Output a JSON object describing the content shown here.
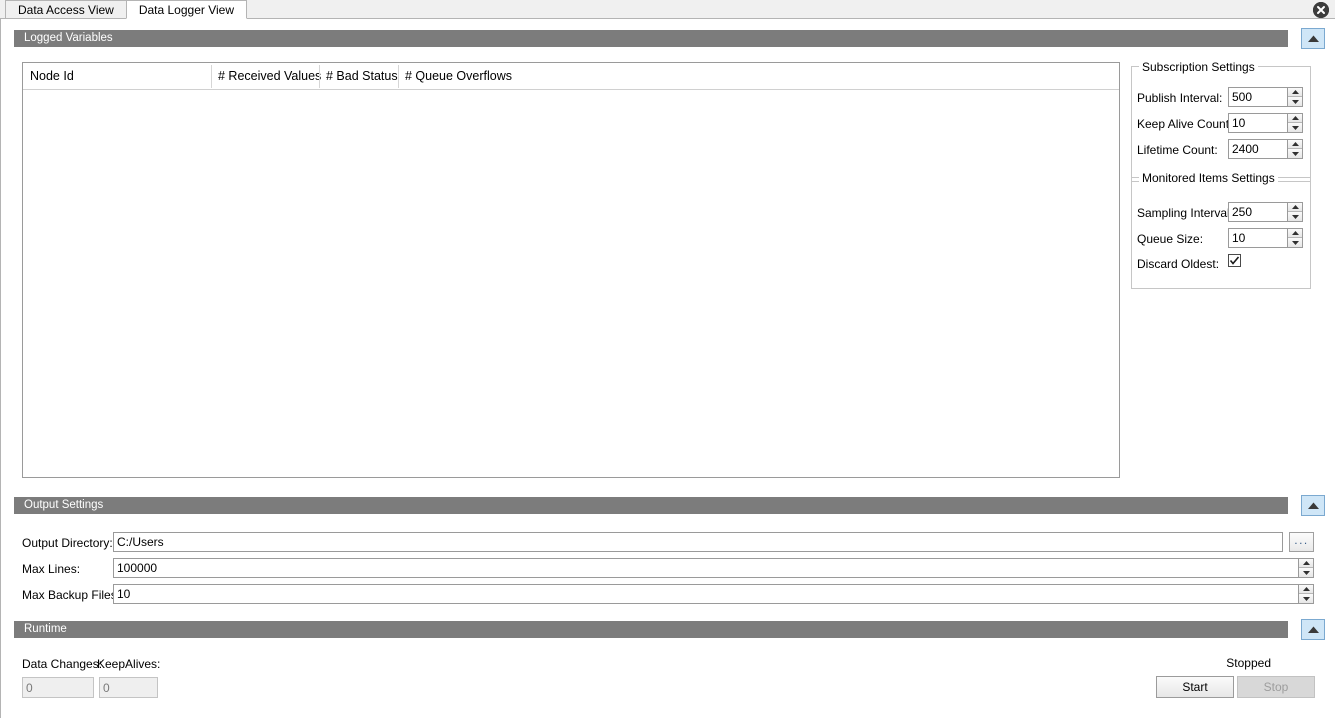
{
  "window": {
    "close_icon": "close-circle-icon"
  },
  "tabs": [
    {
      "label": "Data Access View",
      "selected": false
    },
    {
      "label": "Data Logger View",
      "selected": true
    }
  ],
  "sections": {
    "logged_variables": {
      "title": "Logged Variables",
      "collapse_icon": "chevron-up-icon"
    },
    "output_settings": {
      "title": "Output Settings",
      "collapse_icon": "chevron-up-icon"
    },
    "runtime": {
      "title": "Runtime",
      "collapse_icon": "chevron-up-icon"
    }
  },
  "table": {
    "columns": [
      "Node Id",
      "# Received Values",
      "# Bad Status",
      "# Queue Overflows"
    ],
    "rows": []
  },
  "subscription_settings": {
    "title": "Subscription Settings",
    "fields": [
      {
        "label": "Publish Interval:",
        "value": "500"
      },
      {
        "label": "Keep Alive Count:",
        "value": "10"
      },
      {
        "label": "Lifetime Count:",
        "value": "2400"
      }
    ]
  },
  "monitored_items_settings": {
    "title": "Monitored Items Settings",
    "fields": [
      {
        "label": "Sampling Interval:",
        "value": "250"
      },
      {
        "label": "Queue Size:",
        "value": "10"
      }
    ],
    "discard_oldest": {
      "label": "Discard Oldest:",
      "checked": true,
      "icon": "check-icon"
    }
  },
  "output_settings": {
    "output_directory": {
      "label": "Output Directory:",
      "value": "C:/Users"
    },
    "browse_button": {
      "label": "...",
      "name": "browse-button"
    },
    "max_lines": {
      "label": "Max Lines:",
      "value": "100000"
    },
    "max_backup_files": {
      "label": "Max Backup Files:",
      "value": "10"
    }
  },
  "runtime": {
    "data_changes": {
      "label": "Data Changes:",
      "value": "0"
    },
    "keep_alives": {
      "label": "KeepAlives:",
      "value": "0"
    },
    "status": "Stopped",
    "start_button": "Start",
    "stop_button": "Stop"
  },
  "colors": {
    "section_header_bg": "#7c7c7c",
    "collapse_btn_bg": "#cfe6f7",
    "accent_border": "#7ba9d0",
    "window_bg": "#ffffff"
  }
}
